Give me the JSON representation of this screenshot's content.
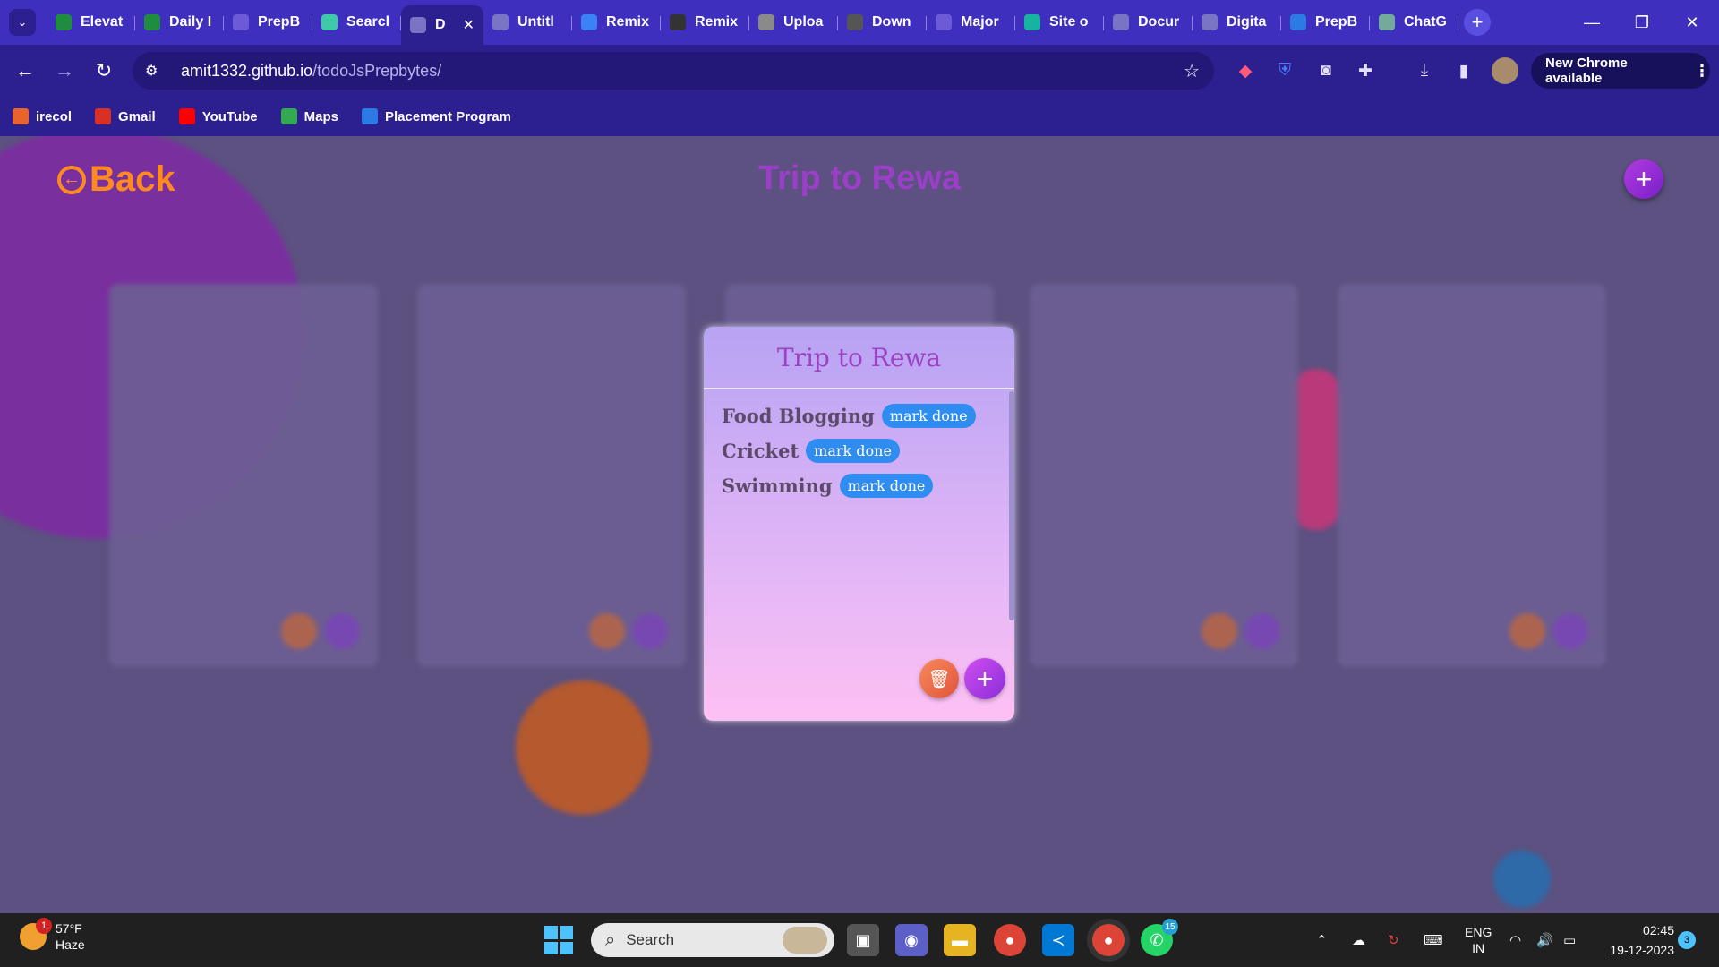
{
  "browser": {
    "tabs": [
      {
        "title": "Elevat",
        "icon": "sheets-icon",
        "color": "#1e8e3e"
      },
      {
        "title": "Daily I",
        "icon": "sheets-icon",
        "color": "#1e8e3e"
      },
      {
        "title": "PrepB",
        "icon": "list-icon",
        "color": "#6b5bd6"
      },
      {
        "title": "Searcl",
        "icon": "v-logo-icon",
        "color": "#3ec9a7"
      },
      {
        "title": "D",
        "icon": "globe-icon",
        "color": "#7a74c4",
        "active": true
      },
      {
        "title": "Untitl",
        "icon": "globe-icon",
        "color": "#7a74c4"
      },
      {
        "title": "Remix",
        "icon": "remix-icon",
        "color": "#3b82f6"
      },
      {
        "title": "Remix",
        "icon": "github-icon",
        "color": "#333333"
      },
      {
        "title": "Uploa",
        "icon": "layers-icon",
        "color": "#8a8a8a"
      },
      {
        "title": "Down",
        "icon": "download-icon",
        "color": "#555555"
      },
      {
        "title": "Major",
        "icon": "list-icon",
        "color": "#6b5bd6"
      },
      {
        "title": "Site o",
        "icon": "diamond-icon",
        "color": "#15b3a0"
      },
      {
        "title": "Docur",
        "icon": "globe-icon",
        "color": "#7a74c4"
      },
      {
        "title": "Digita",
        "icon": "globe-icon",
        "color": "#7a74c4"
      },
      {
        "title": "PrepB",
        "icon": "pb-icon",
        "color": "#2c7be5"
      },
      {
        "title": "ChatG",
        "icon": "chatgpt-icon",
        "color": "#74aa9c"
      }
    ],
    "url_host": "amit1332.github.io",
    "url_path": "/todoJsPrepbytes/",
    "new_chrome_label": "New Chrome available",
    "bookmarks": [
      {
        "label": "irecol",
        "icon": "irecol-icon",
        "color": "#e8632d"
      },
      {
        "label": "Gmail",
        "icon": "gmail-icon",
        "color": "#d93025"
      },
      {
        "label": "YouTube",
        "icon": "youtube-icon",
        "color": "#ff0000"
      },
      {
        "label": "Maps",
        "icon": "maps-icon",
        "color": "#34a853"
      },
      {
        "label": "Placement Program",
        "icon": "pb-icon",
        "color": "#2c7be5"
      }
    ]
  },
  "app": {
    "back_label": "Back",
    "page_title": "Trip to Rewa",
    "accent_color": "#9b3ec8",
    "modal": {
      "title": "Trip to Rewa",
      "items": [
        {
          "name": "Food Blogging",
          "action": "mark done"
        },
        {
          "name": "Cricket",
          "action": "mark done"
        },
        {
          "name": "Swimming",
          "action": "mark done"
        }
      ]
    }
  },
  "taskbar": {
    "weather_temp": "57°F",
    "weather_desc": "Haze",
    "weather_badge": "1",
    "search_placeholder": "Search",
    "whatsapp_badge": "15",
    "lang_1": "ENG",
    "lang_2": "IN",
    "time": "02:45",
    "date": "19-12-2023",
    "notification_count": "3"
  }
}
